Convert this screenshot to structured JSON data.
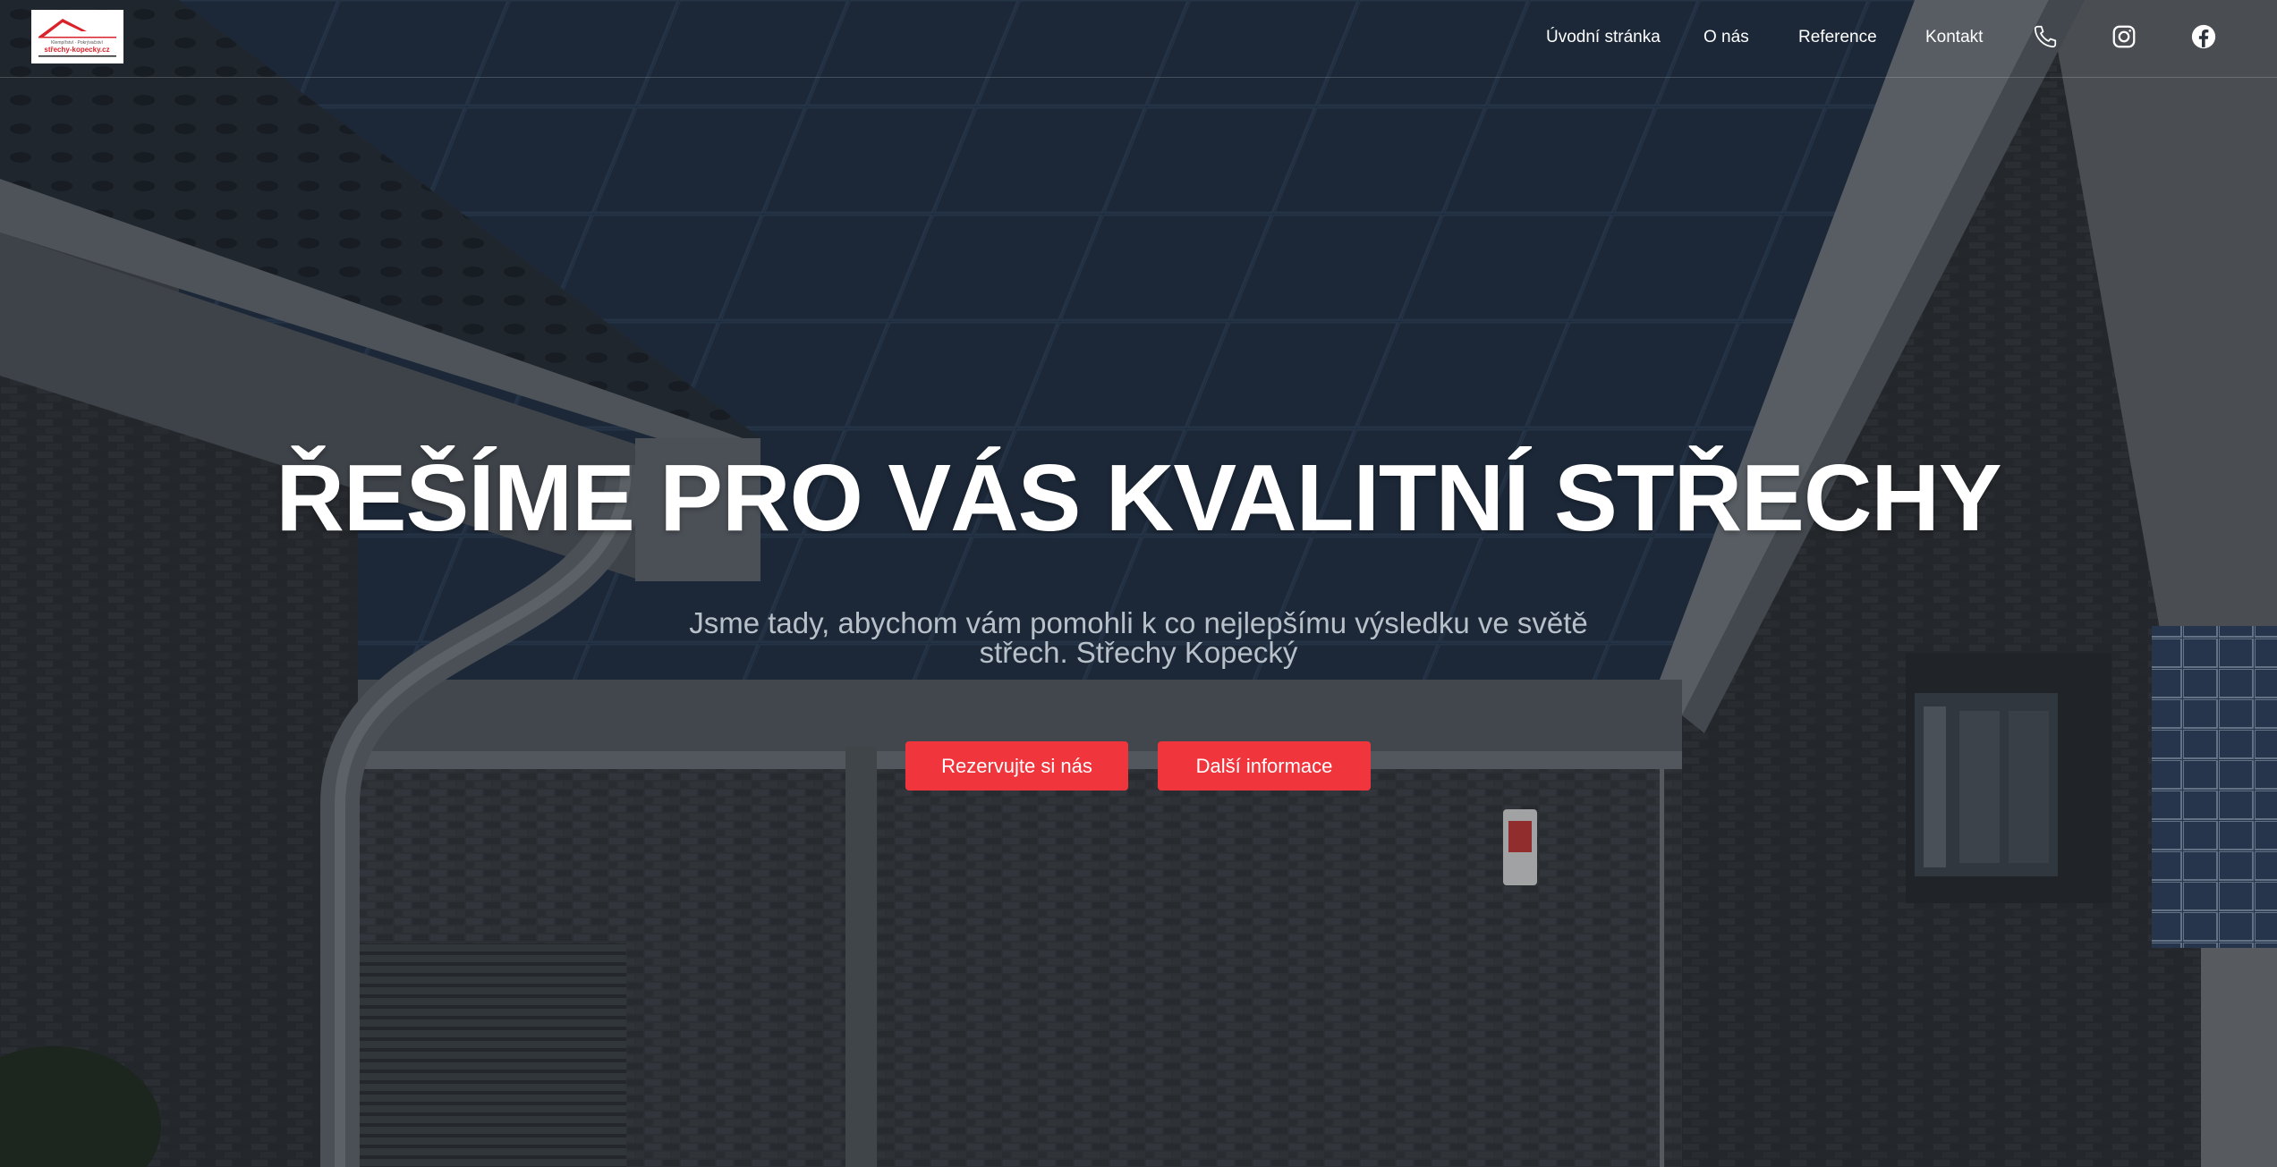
{
  "brand": {
    "logo_top_text": "Klempířství · Pokrývačství",
    "logo_main_text": "střechy-kopecky.cz"
  },
  "nav": {
    "items": [
      {
        "label": "Úvodní stránka"
      },
      {
        "label": "O nás"
      },
      {
        "label": "Reference"
      },
      {
        "label": "Kontakt"
      }
    ],
    "icons": [
      "phone-icon",
      "instagram-icon",
      "facebook-icon"
    ]
  },
  "hero": {
    "headline": "ŘEŠÍME PRO VÁS KVALITNÍ STŘECHY",
    "subtitle": "Jsme tady, abychom vám pomohli k co nejlepšímu výsledku ve světě střech. Střechy Kopecký",
    "primary_button": "Rezervujte si nás",
    "secondary_button": "Další informace"
  },
  "colors": {
    "accent": "#f0353c",
    "text": "#ffffff",
    "subtitle": "#b8c0c9",
    "logo_red": "#d8232a"
  }
}
